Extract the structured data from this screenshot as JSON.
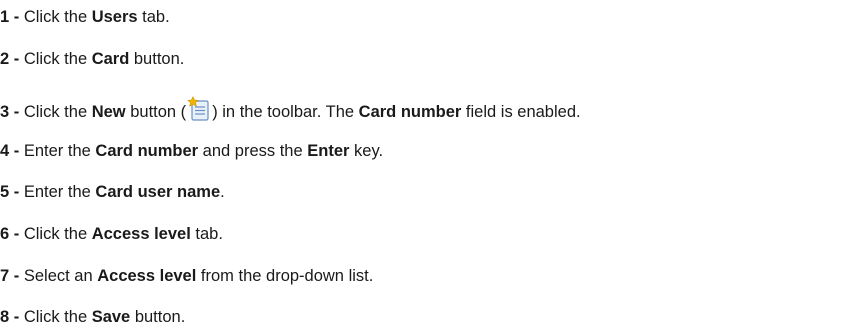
{
  "steps": [
    {
      "num": "1 -",
      "parts": [
        " Click the ",
        "Users",
        " tab."
      ]
    },
    {
      "num": "2 -",
      "parts": [
        " Click the ",
        "Card",
        " button."
      ]
    },
    {
      "num": "3 -",
      "parts": [
        " Click the ",
        "New",
        " button (",
        ") in the toolbar. The ",
        "Card number",
        " field is enabled."
      ],
      "icon": "new-document-icon"
    },
    {
      "num": "4 -",
      "parts": [
        " Enter the ",
        "Card number",
        " and press the ",
        "Enter",
        " key."
      ]
    },
    {
      "num": "5 -",
      "parts": [
        " Enter the ",
        "Card user name",
        "."
      ]
    },
    {
      "num": "6 -",
      "parts": [
        " Click the ",
        "Access level",
        " tab."
      ]
    },
    {
      "num": "7 -",
      "parts": [
        " Select an ",
        "Access level",
        " from the drop-down list."
      ]
    },
    {
      "num": "8 -",
      "parts": [
        " Click the ",
        "Save",
        " button."
      ]
    }
  ],
  "colors": {
    "icon_star": "#f0b400",
    "icon_border": "#6b8fbf",
    "icon_fill": "#e8f0fa",
    "text": "#1a1a1a"
  }
}
